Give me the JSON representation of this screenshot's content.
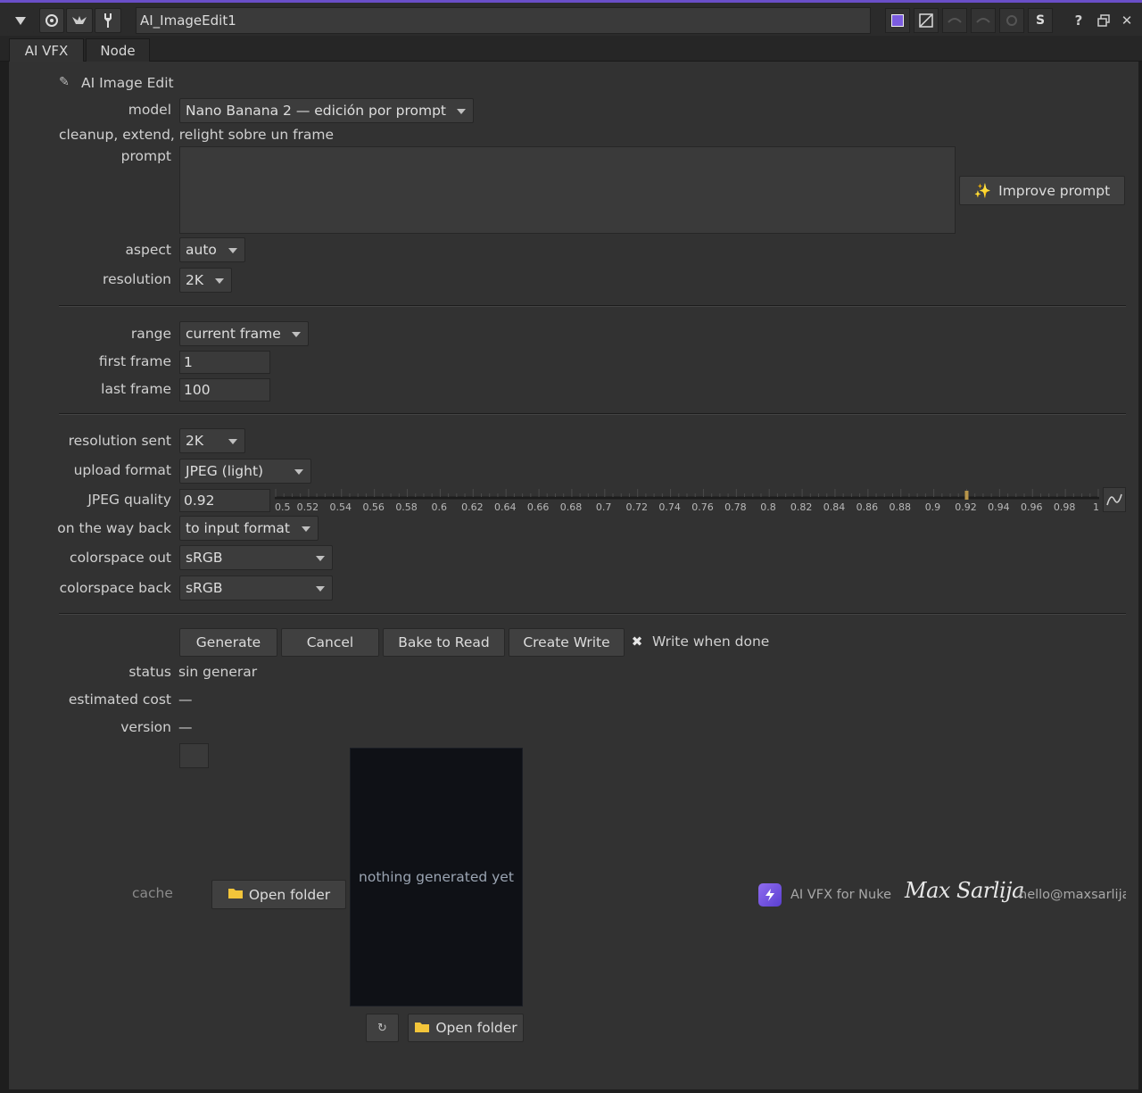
{
  "window": {
    "node_name": "AI_ImageEdit1",
    "icons": [
      "triangle-down-icon",
      "target-icon",
      "bird-icon",
      "wrench-icon"
    ],
    "right_icons": [
      "color-swatch-icon",
      "mask-icon",
      "undo-icon",
      "redo-icon",
      "revert-icon",
      "s-icon",
      "help-icon",
      "float-icon",
      "close-icon"
    ],
    "right_text": {
      "s": "S",
      "help": "?",
      "close": "✕"
    },
    "accent": "#6a4fc8"
  },
  "tabs": [
    {
      "label": "AI VFX"
    },
    {
      "label": "Node"
    }
  ],
  "header": {
    "icon": "✎",
    "title": "AI Image Edit"
  },
  "model": {
    "label": "model",
    "value": "Nano Banana 2 — edición por prompt"
  },
  "description": "cleanup, extend, relight sobre un frame",
  "prompt": {
    "label": "prompt",
    "value": ""
  },
  "improve_prompt": {
    "icon": "✨",
    "label": "Improve prompt"
  },
  "aspect": {
    "label": "aspect",
    "value": "auto"
  },
  "resolution": {
    "label": "resolution",
    "value": "2K"
  },
  "range": {
    "label": "range",
    "value": "current frame"
  },
  "first_frame": {
    "label": "first frame",
    "value": "1"
  },
  "last_frame": {
    "label": "last frame",
    "value": "100"
  },
  "resolution_sent": {
    "label": "resolution sent",
    "value": "2K"
  },
  "upload_format": {
    "label": "upload format",
    "value": "JPEG (light)"
  },
  "jpeg_quality": {
    "label": "JPEG quality",
    "value": "0.92",
    "ticks": [
      "0.5",
      "0.52",
      "0.54",
      "0.56",
      "0.58",
      "0.6",
      "0.62",
      "0.64",
      "0.66",
      "0.68",
      "0.7",
      "0.72",
      "0.74",
      "0.76",
      "0.78",
      "0.8",
      "0.82",
      "0.84",
      "0.86",
      "0.88",
      "0.9",
      "0.92",
      "0.94",
      "0.96",
      "0.98",
      "1"
    ],
    "min": 0.5,
    "max": 1,
    "current": 0.92
  },
  "way_back": {
    "label": "on the way back",
    "value": "to input format"
  },
  "colorspace_out": {
    "label": "colorspace out",
    "value": "sRGB"
  },
  "colorspace_back": {
    "label": "colorspace back",
    "value": "sRGB"
  },
  "actions": {
    "generate": "Generate",
    "cancel": "Cancel",
    "bake": "Bake to Read",
    "create_write": "Create Write",
    "write_when_done": "Write when done",
    "write_when_done_checked": true
  },
  "status": {
    "label": "status",
    "value": "sin generar"
  },
  "estimated_cost": {
    "label": "estimated cost",
    "value": "—"
  },
  "version": {
    "label": "version",
    "value": "—"
  },
  "cache": {
    "label": "cache",
    "open_folder": "Open folder"
  },
  "preview": {
    "text": "nothing generated yet",
    "open_folder": "Open folder",
    "refresh_icon": "↻"
  },
  "footer": {
    "product": "AI VFX for Nuke",
    "signature": "Max Sarlija",
    "email": "hello@maxsarlija"
  }
}
